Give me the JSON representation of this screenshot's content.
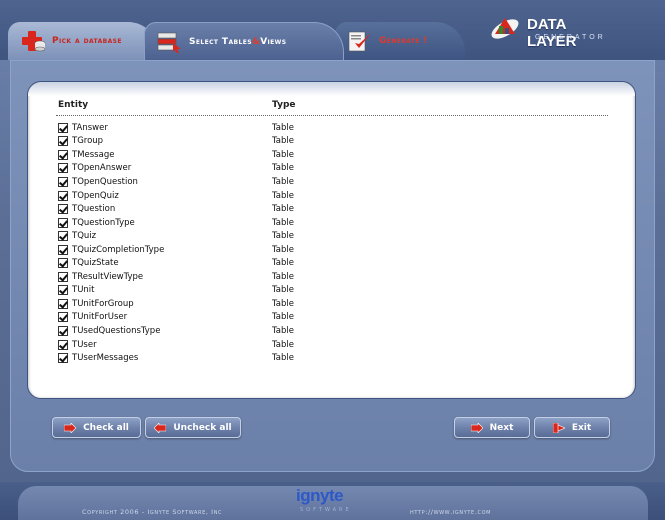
{
  "tabs": [
    {
      "label": "Pick a database"
    },
    {
      "label_a": "Select Tables ",
      "label_amp": "&",
      "label_b": " Views"
    },
    {
      "label": "Generate !"
    }
  ],
  "logo": {
    "title": "DATA LAYER",
    "subtitle": "GENERATOR"
  },
  "table": {
    "col_entity": "Entity",
    "col_type": "Type",
    "rows": [
      {
        "name": "TAnswer",
        "type": "Table",
        "checked": true
      },
      {
        "name": "TGroup",
        "type": "Table",
        "checked": true
      },
      {
        "name": "TMessage",
        "type": "Table",
        "checked": true
      },
      {
        "name": "TOpenAnswer",
        "type": "Table",
        "checked": true
      },
      {
        "name": "TOpenQuestion",
        "type": "Table",
        "checked": true
      },
      {
        "name": "TOpenQuiz",
        "type": "Table",
        "checked": true
      },
      {
        "name": "TQuestion",
        "type": "Table",
        "checked": true
      },
      {
        "name": "TQuestionType",
        "type": "Table",
        "checked": true
      },
      {
        "name": "TQuiz",
        "type": "Table",
        "checked": true
      },
      {
        "name": "TQuizCompletionType",
        "type": "Table",
        "checked": true
      },
      {
        "name": "TQuizState",
        "type": "Table",
        "checked": true
      },
      {
        "name": "TResultViewType",
        "type": "Table",
        "checked": true
      },
      {
        "name": "TUnit",
        "type": "Table",
        "checked": true
      },
      {
        "name": "TUnitForGroup",
        "type": "Table",
        "checked": true
      },
      {
        "name": "TUnitForUser",
        "type": "Table",
        "checked": true
      },
      {
        "name": "TUsedQuestionsType",
        "type": "Table",
        "checked": true
      },
      {
        "name": "TUser",
        "type": "Table",
        "checked": true
      },
      {
        "name": "TUserMessages",
        "type": "Table",
        "checked": true
      }
    ]
  },
  "buttons": {
    "check_all": "Check all",
    "uncheck_all": "Uncheck all",
    "next": "Next",
    "exit": "Exit"
  },
  "footer": {
    "copyright": "Copyright 2006 - Ignyte Software, Inc",
    "brand": "ignyte",
    "brand_sub": "SOFTWARE",
    "url": "http://www.ignyte.com"
  },
  "colors": {
    "accent_red": "#e23b2a",
    "frame_blue": "#6b80a9",
    "brand_blue": "#2d58c8"
  }
}
